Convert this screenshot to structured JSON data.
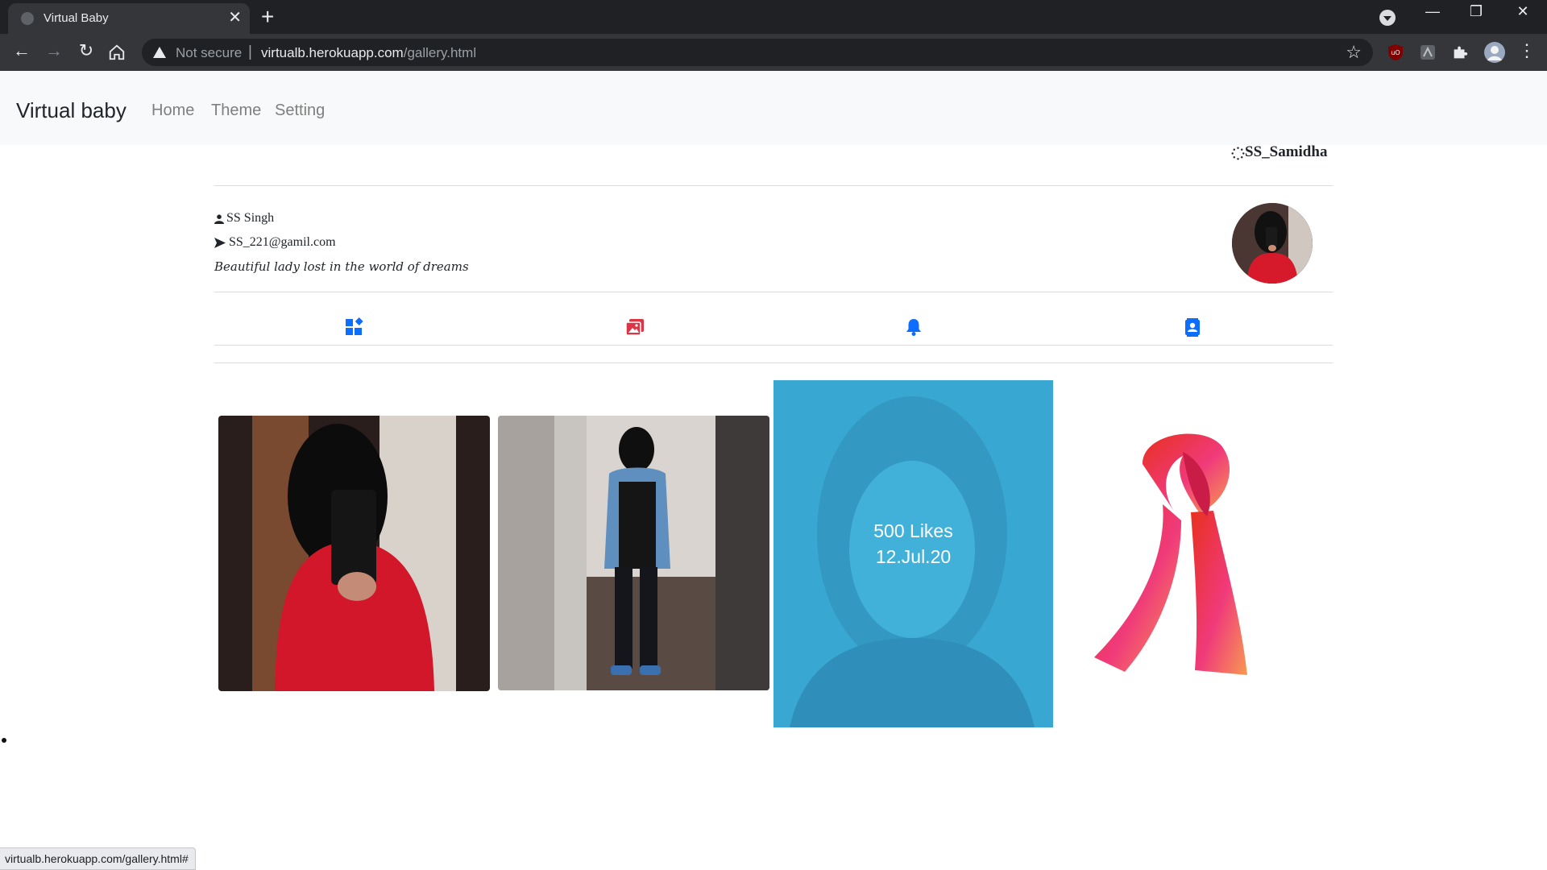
{
  "browser": {
    "tab_title": "Virtual Baby",
    "tab_close": "✕",
    "new_tab": "+",
    "not_secure": "Not secure",
    "url_host": "virtualb.herokuapp.com",
    "url_path": "/gallery.html",
    "status_url": "virtualb.herokuapp.com/gallery.html#"
  },
  "navbar": {
    "brand": "Virtual baby",
    "links": [
      "Home",
      "Theme",
      "Setting"
    ]
  },
  "profile": {
    "username": "SS_Samidha",
    "name": "SS Singh",
    "email": "SS_221@gamil.com",
    "bio": "Beautiful lady lost in the world of dreams"
  },
  "gallery": {
    "highlight": {
      "likes": "500 Likes",
      "date": "12.Jul.20"
    }
  },
  "colors": {
    "accent_blue": "#0d6efd",
    "accent_red": "#dc3545",
    "overlay": "#38a8d2"
  }
}
